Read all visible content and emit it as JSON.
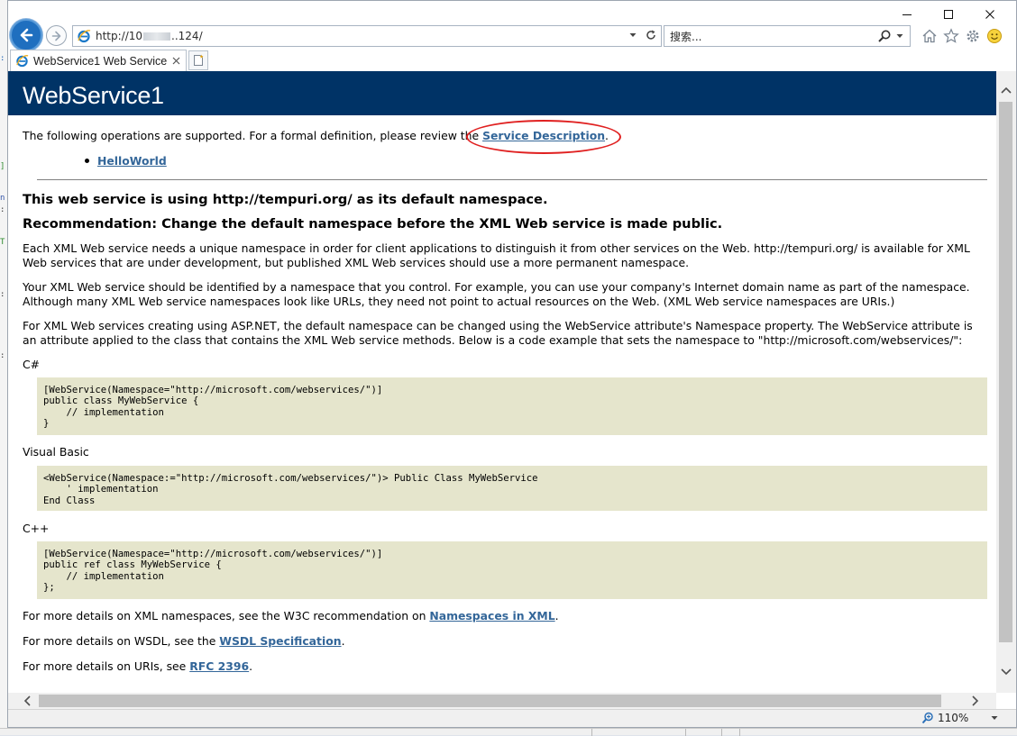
{
  "window": {
    "minimize_label": "Minimize",
    "maximize_label": "Maximize",
    "close_label": "Close"
  },
  "nav": {
    "url_prefix": "http://10",
    "url_suffix": "..124/",
    "search_placeholder": "搜索..."
  },
  "tab": {
    "title": "WebService1 Web Service"
  },
  "page": {
    "heading": "WebService1",
    "intro": "The following operations are supported. For a formal definition, please review the ",
    "service_description_link": "Service Description",
    "intro_end": ".",
    "operations": [
      "HelloWorld"
    ],
    "ns_heading": "This web service is using http://tempuri.org/ as its default namespace.",
    "recommendation_heading": "Recommendation: Change the default namespace before the XML Web service is made public.",
    "para1": "Each XML Web service needs a unique namespace in order for client applications to distinguish it from other services on the Web. http://tempuri.org/ is available for XML Web services that are under development, but published XML Web services should use a more permanent namespace.",
    "para2": "Your XML Web service should be identified by a namespace that you control. For example, you can use your company's Internet domain name as part of the namespace. Although many XML Web service namespaces look like URLs, they need not point to actual resources on the Web. (XML Web service namespaces are URIs.)",
    "para3": "For XML Web services creating using ASP.NET, the default namespace can be changed using the WebService attribute's Namespace property. The WebService attribute is an attribute applied to the class that contains the XML Web service methods. Below is a code example that sets the namespace to \"http://microsoft.com/webservices/\":",
    "csharp_label": "C#",
    "csharp_code": "[WebService(Namespace=\"http://microsoft.com/webservices/\")]\npublic class MyWebService {\n    // implementation\n}",
    "vb_label": "Visual Basic",
    "vb_code": "<WebService(Namespace:=\"http://microsoft.com/webservices/\")> Public Class MyWebService\n    ' implementation\nEnd Class",
    "cpp_label": "C++",
    "cpp_code": "[WebService(Namespace=\"http://microsoft.com/webservices/\")]\npublic ref class MyWebService {\n    // implementation\n};",
    "xml_ns_text": "For more details on XML namespaces, see the W3C recommendation on ",
    "xml_ns_link": "Namespaces in XML",
    "wsdl_text": "For more details on WSDL, see the ",
    "wsdl_link": "WSDL Specification",
    "uri_text": "For more details on URIs, see ",
    "uri_link": "RFC 2396",
    "period": "."
  },
  "status": {
    "zoom": "110%"
  },
  "colors": {
    "heading_band": "#003366",
    "link": "#336699",
    "code_bg": "#e5e5cc",
    "annotation": "#e02020"
  }
}
